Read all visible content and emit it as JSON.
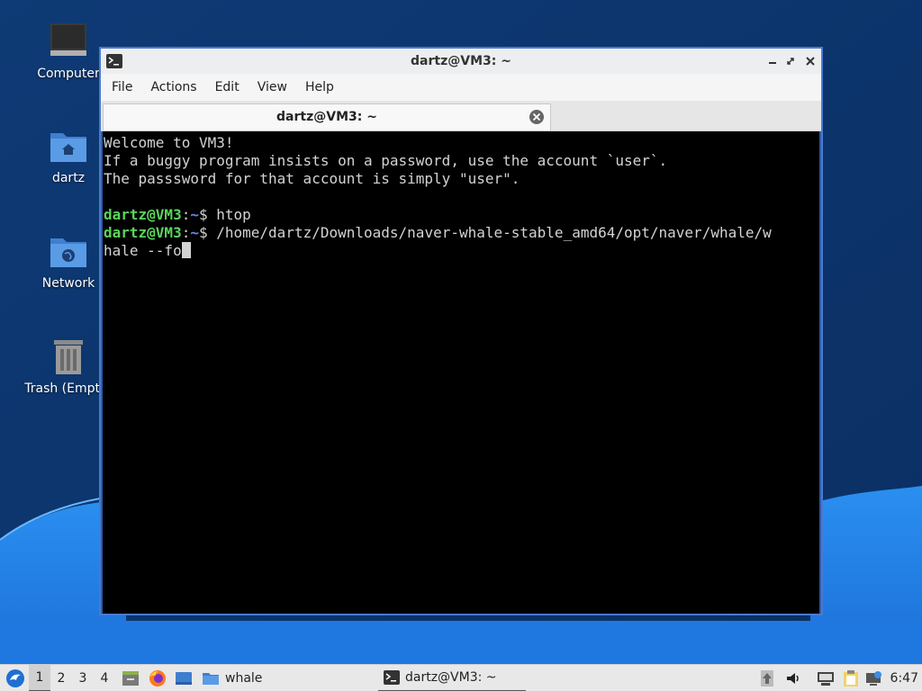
{
  "desktop": {
    "icons": [
      {
        "label": "Computer",
        "icon": "monitor-icon"
      },
      {
        "label": "dartz",
        "icon": "home-folder-icon"
      },
      {
        "label": "Network",
        "icon": "network-folder-icon"
      },
      {
        "label": "Trash (Empty)",
        "icon": "trash-icon"
      }
    ]
  },
  "window": {
    "title": "dartz@VM3: ~",
    "menu": [
      "File",
      "Actions",
      "Edit",
      "View",
      "Help"
    ],
    "tab_label": "dartz@VM3: ~"
  },
  "terminal": {
    "welcome": [
      "Welcome to VM3!",
      "If a buggy program insists on a password, use the account `user`.",
      "The passsword for that account is simply \"user\"."
    ],
    "prompt_user": "dartz@VM3",
    "prompt_sep": ":",
    "prompt_path": "~",
    "prompt_dollar": "$ ",
    "commands": [
      "htop",
      "/home/dartz/Downloads/naver-whale-stable_amd64/opt/naver/whale/w"
    ],
    "continuation": "hale --fo"
  },
  "taskbar": {
    "workspaces": [
      "1",
      "2",
      "3",
      "4"
    ],
    "active_workspace": "1",
    "folder_task_label": "whale",
    "terminal_task_label": "dartz@VM3: ~",
    "clock": "6:47"
  },
  "colors": {
    "prompt_user": "#5bd45b",
    "prompt_path": "#5d8cf0",
    "terminal_bg": "#000000",
    "terminal_fg": "#d3d3d3"
  }
}
